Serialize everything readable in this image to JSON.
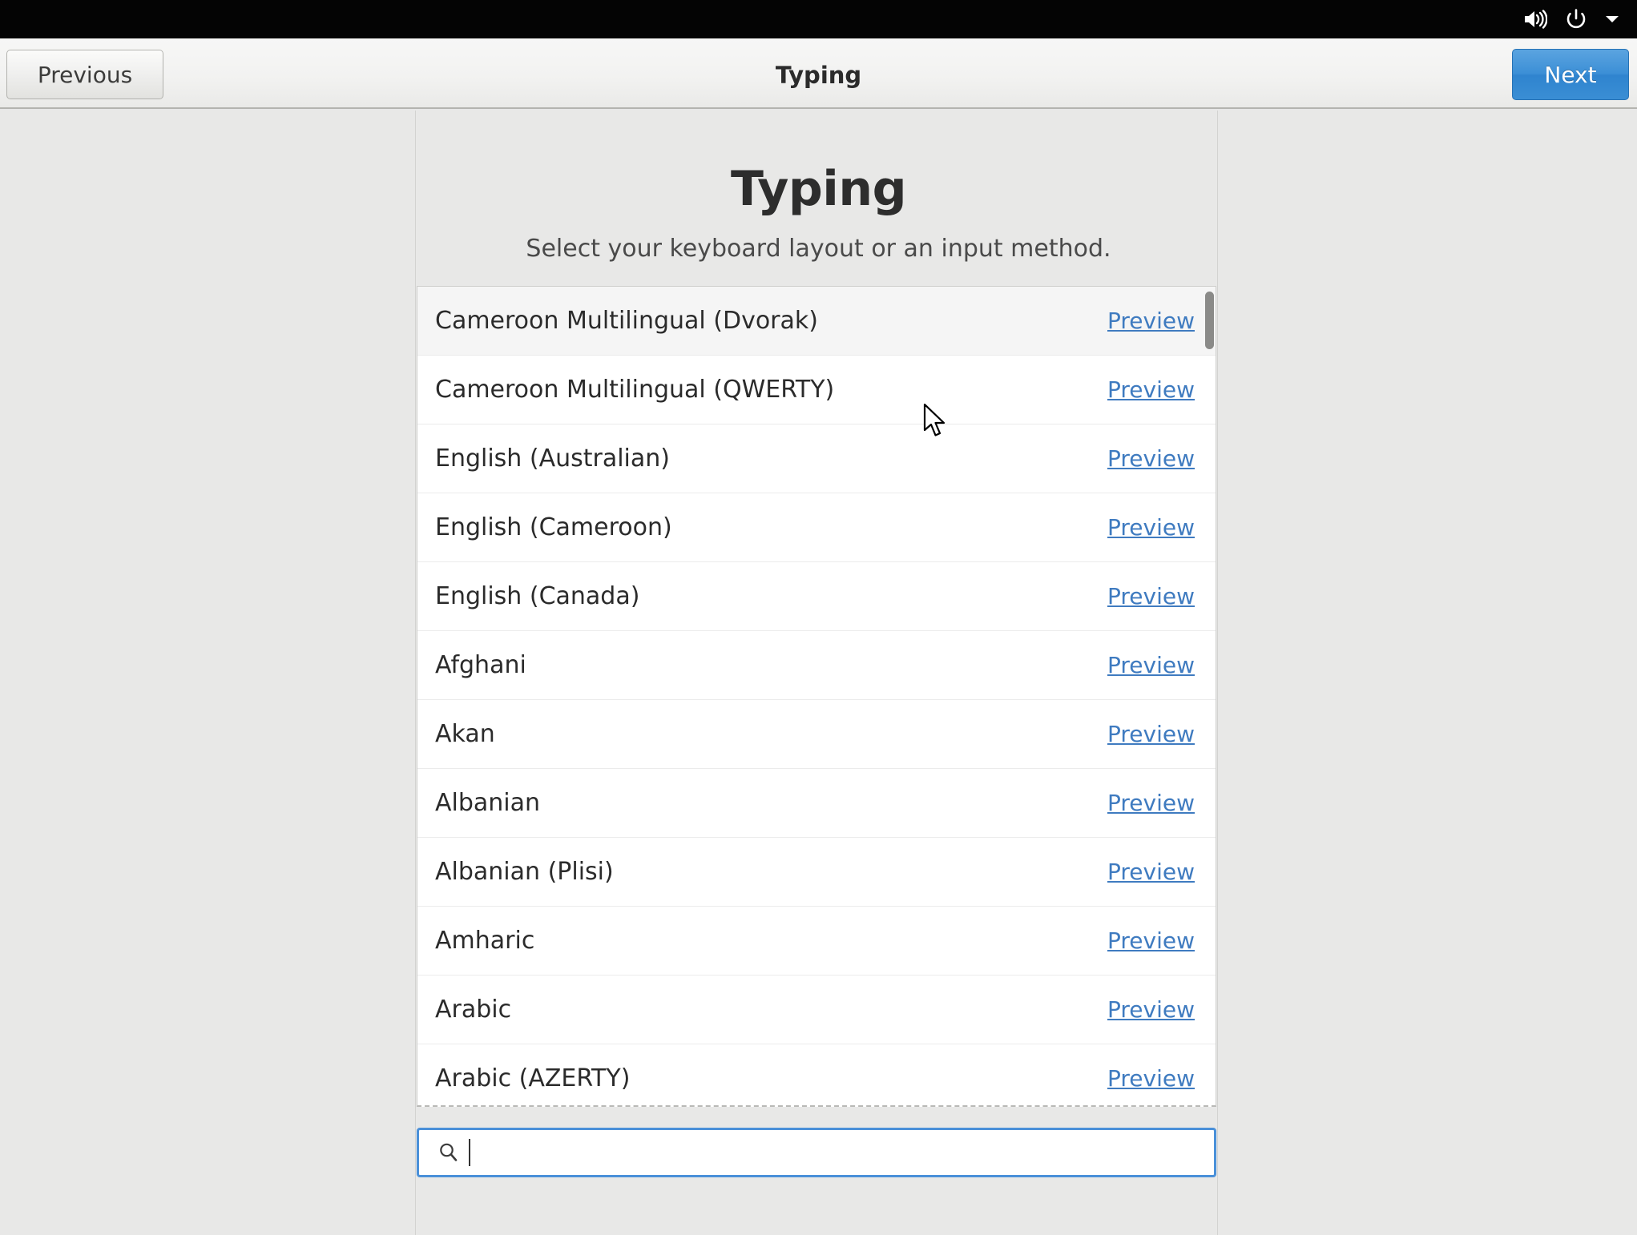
{
  "system_tray": {
    "icons": [
      {
        "name": "volume-icon",
        "label": "Volume"
      },
      {
        "name": "power-icon",
        "label": "Power"
      },
      {
        "name": "chevron-down-icon",
        "label": "System menu"
      }
    ]
  },
  "header": {
    "previous_label": "Previous",
    "title": "Typing",
    "next_label": "Next"
  },
  "page": {
    "title": "Typing",
    "subtitle": "Select your keyboard layout or an input method."
  },
  "layouts": {
    "preview_label": "Preview",
    "items": [
      {
        "name": "Cameroon Multilingual (Dvorak)",
        "hovered": true
      },
      {
        "name": "Cameroon Multilingual (QWERTY)",
        "hovered": false
      },
      {
        "name": "English (Australian)",
        "hovered": false
      },
      {
        "name": "English (Cameroon)",
        "hovered": false
      },
      {
        "name": "English (Canada)",
        "hovered": false
      },
      {
        "name": "Afghani",
        "hovered": false
      },
      {
        "name": "Akan",
        "hovered": false
      },
      {
        "name": "Albanian",
        "hovered": false
      },
      {
        "name": "Albanian (Plisi)",
        "hovered": false
      },
      {
        "name": "Amharic",
        "hovered": false
      },
      {
        "name": "Arabic",
        "hovered": false
      },
      {
        "name": "Arabic (AZERTY)",
        "hovered": false
      }
    ]
  },
  "search": {
    "value": "",
    "placeholder": "",
    "icon": "search-icon"
  },
  "colors": {
    "accent_blue": "#3a8ed4",
    "link_blue": "#3f7bc0",
    "focus_blue": "#4a90d9",
    "page_background": "#e8e8e7",
    "topbar_background": "#040404"
  }
}
